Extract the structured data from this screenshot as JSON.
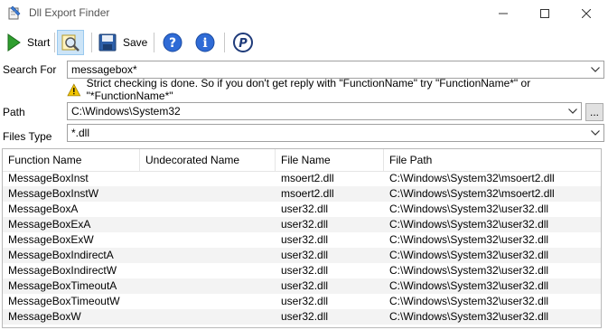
{
  "window": {
    "title": "Dll Export Finder"
  },
  "toolbar": {
    "start_label": "Start",
    "save_label": "Save"
  },
  "search": {
    "label": "Search For",
    "value": "messagebox*",
    "hint": "Strict checking is done. So if you don't get reply with \"FunctionName\" try \"FunctionName*\" or \"*FunctionName*\""
  },
  "path": {
    "label": "Path",
    "value": "C:\\Windows\\System32",
    "browse_label": "..."
  },
  "files_type": {
    "label": "Files Type",
    "value": "*.dll"
  },
  "results": {
    "columns": [
      "Function Name",
      "Undecorated Name",
      "File Name",
      "File Path"
    ],
    "rows": [
      [
        "MessageBoxInst",
        "",
        "msoert2.dll",
        "C:\\Windows\\System32\\msoert2.dll"
      ],
      [
        "MessageBoxInstW",
        "",
        "msoert2.dll",
        "C:\\Windows\\System32\\msoert2.dll"
      ],
      [
        "MessageBoxA",
        "",
        "user32.dll",
        "C:\\Windows\\System32\\user32.dll"
      ],
      [
        "MessageBoxExA",
        "",
        "user32.dll",
        "C:\\Windows\\System32\\user32.dll"
      ],
      [
        "MessageBoxExW",
        "",
        "user32.dll",
        "C:\\Windows\\System32\\user32.dll"
      ],
      [
        "MessageBoxIndirectA",
        "",
        "user32.dll",
        "C:\\Windows\\System32\\user32.dll"
      ],
      [
        "MessageBoxIndirectW",
        "",
        "user32.dll",
        "C:\\Windows\\System32\\user32.dll"
      ],
      [
        "MessageBoxTimeoutA",
        "",
        "user32.dll",
        "C:\\Windows\\System32\\user32.dll"
      ],
      [
        "MessageBoxTimeoutW",
        "",
        "user32.dll",
        "C:\\Windows\\System32\\user32.dll"
      ],
      [
        "MessageBoxW",
        "",
        "user32.dll",
        "C:\\Windows\\System32\\user32.dll"
      ]
    ]
  },
  "colors": {
    "accent": "#cce4f7",
    "start_green": "#2e9e2e",
    "help_blue": "#2f6bd6",
    "warn_yellow": "#f2c500"
  },
  "icons": [
    "app-icon",
    "start-icon",
    "search-icon",
    "save-icon",
    "help-icon",
    "info-icon",
    "paypal-icon",
    "warning-icon",
    "chevron-down-icon"
  ]
}
